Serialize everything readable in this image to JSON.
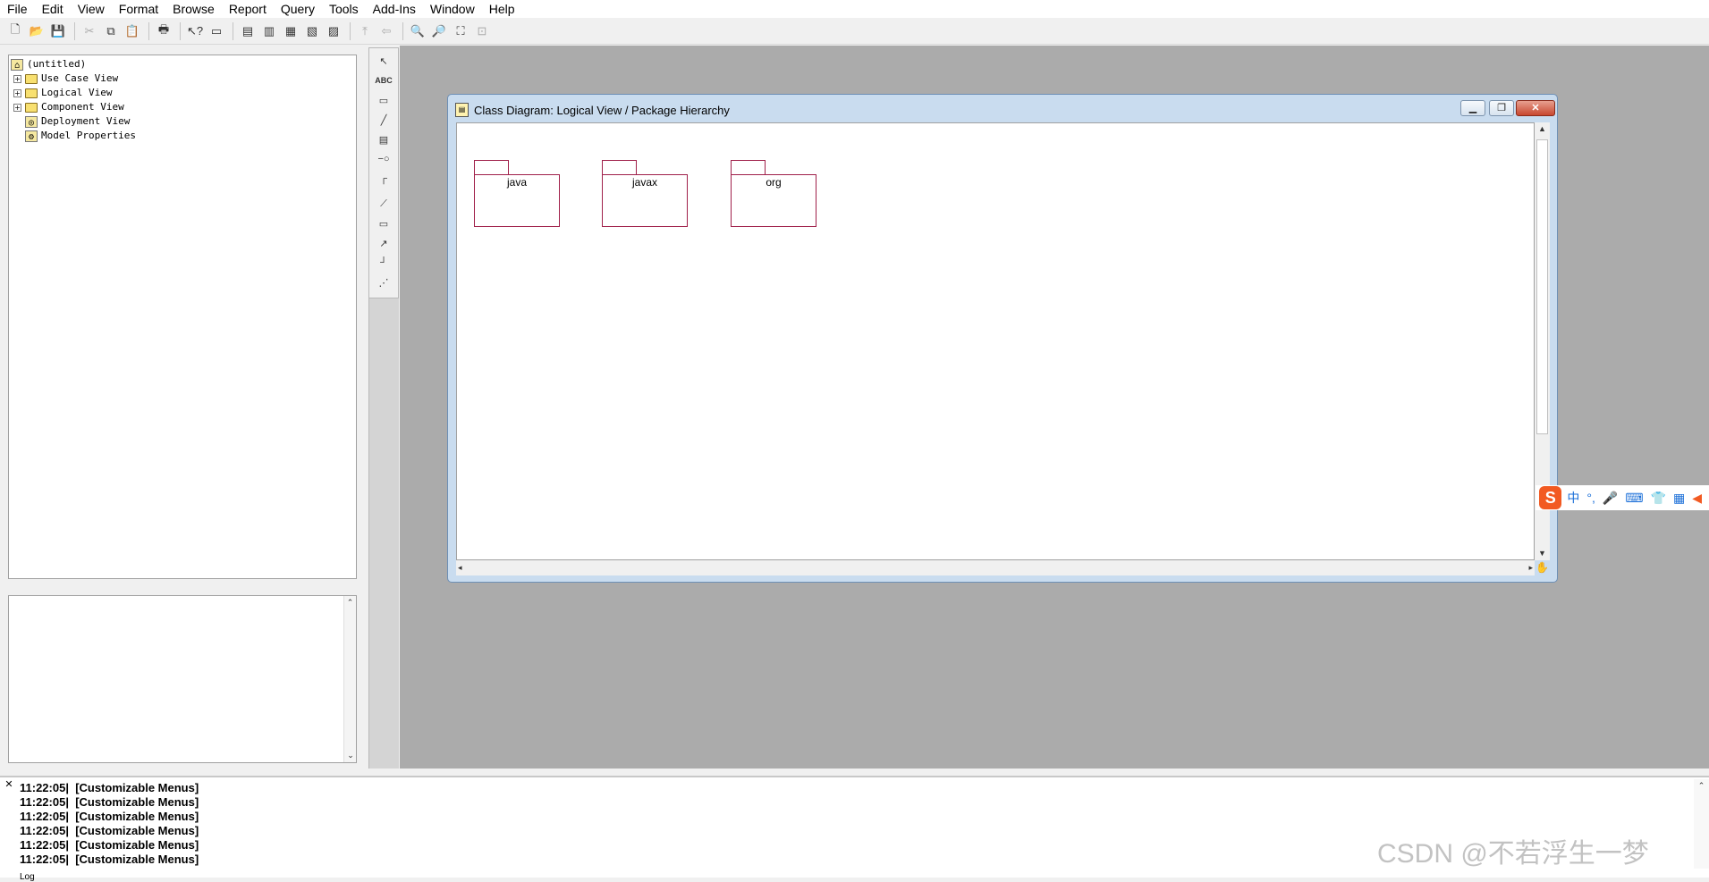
{
  "menu": [
    "File",
    "Edit",
    "View",
    "Format",
    "Browse",
    "Report",
    "Query",
    "Tools",
    "Add-Ins",
    "Window",
    "Help"
  ],
  "toolbar": {
    "icons": [
      "new-icon",
      "open-icon",
      "save-icon",
      "cut-icon",
      "copy-icon",
      "paste-icon",
      "print-icon",
      "context-help-icon",
      "view-doc-icon",
      "browse-class-icon",
      "browse-interaction-icon",
      "browse-component-icon",
      "browse-state-icon",
      "browse-deployment-icon",
      "browse-parent-icon",
      "browse-previous-icon",
      "zoom-in-icon",
      "zoom-out-icon",
      "fit-window-icon",
      "undo-fit-icon"
    ]
  },
  "browser": {
    "root": "(untitled)",
    "items": [
      {
        "label": "Use Case View",
        "expandable": true
      },
      {
        "label": "Logical View",
        "expandable": true
      },
      {
        "label": "Component View",
        "expandable": true
      },
      {
        "label": "Deployment View",
        "expandable": false
      },
      {
        "label": "Model Properties",
        "expandable": false
      }
    ]
  },
  "diagram_window": {
    "title": "Class Diagram: Logical View / Package Hierarchy",
    "packages": [
      {
        "name": "java"
      },
      {
        "name": "javax"
      },
      {
        "name": "org"
      }
    ]
  },
  "ime": {
    "logo": "S",
    "mode": "中",
    "punct": "°,"
  },
  "log": {
    "lines": [
      {
        "time": "11:22:05|",
        "msg": "[Customizable Menus]"
      },
      {
        "time": "11:22:05|",
        "msg": "[Customizable Menus]"
      },
      {
        "time": "11:22:05|",
        "msg": "[Customizable Menus]"
      },
      {
        "time": "11:22:05|",
        "msg": "[Customizable Menus]"
      },
      {
        "time": "11:22:05|",
        "msg": "[Customizable Menus]"
      },
      {
        "time": "11:22:05|",
        "msg": "[Customizable Menus]"
      }
    ],
    "tab": "Log"
  },
  "watermark": "CSDN @不若浮生一梦"
}
